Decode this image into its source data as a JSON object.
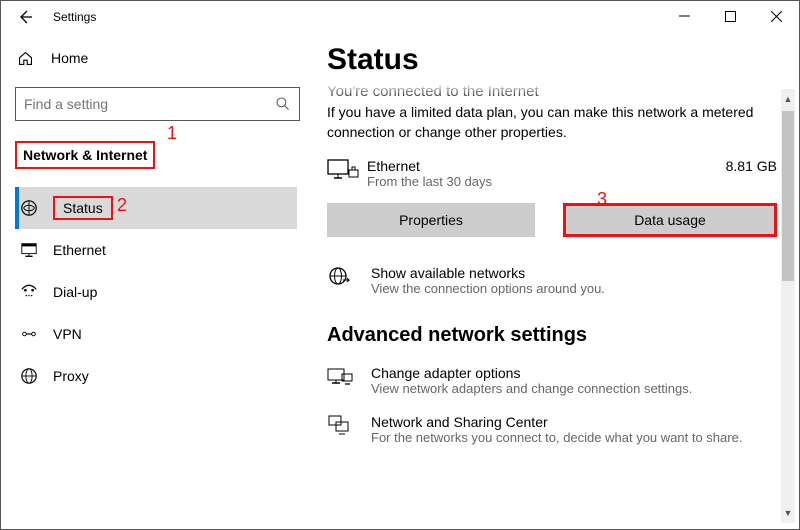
{
  "titlebar": {
    "title": "Settings"
  },
  "sidebar": {
    "home_label": "Home",
    "search_placeholder": "Find a setting",
    "section": "Network & Internet",
    "items": [
      {
        "label": "Status"
      },
      {
        "label": "Ethernet"
      },
      {
        "label": "Dial-up"
      },
      {
        "label": "VPN"
      },
      {
        "label": "Proxy"
      }
    ]
  },
  "annotations": {
    "a1": "1",
    "a2": "2",
    "a3": "3"
  },
  "main": {
    "heading": "Status",
    "truncated_line": "You're connected to the Internet",
    "description": "If you have a limited data plan, you can make this network a metered connection or change other properties.",
    "network": {
      "name": "Ethernet",
      "sub": "From the last 30 days",
      "usage": "8.81 GB"
    },
    "buttons": {
      "properties": "Properties",
      "data_usage": "Data usage"
    },
    "show_networks": {
      "title": "Show available networks",
      "sub": "View the connection options around you."
    },
    "advanced_heading": "Advanced network settings",
    "adapter": {
      "title": "Change adapter options",
      "sub": "View network adapters and change connection settings."
    },
    "sharing": {
      "title": "Network and Sharing Center",
      "sub": "For the networks you connect to, decide what you want to share."
    }
  }
}
